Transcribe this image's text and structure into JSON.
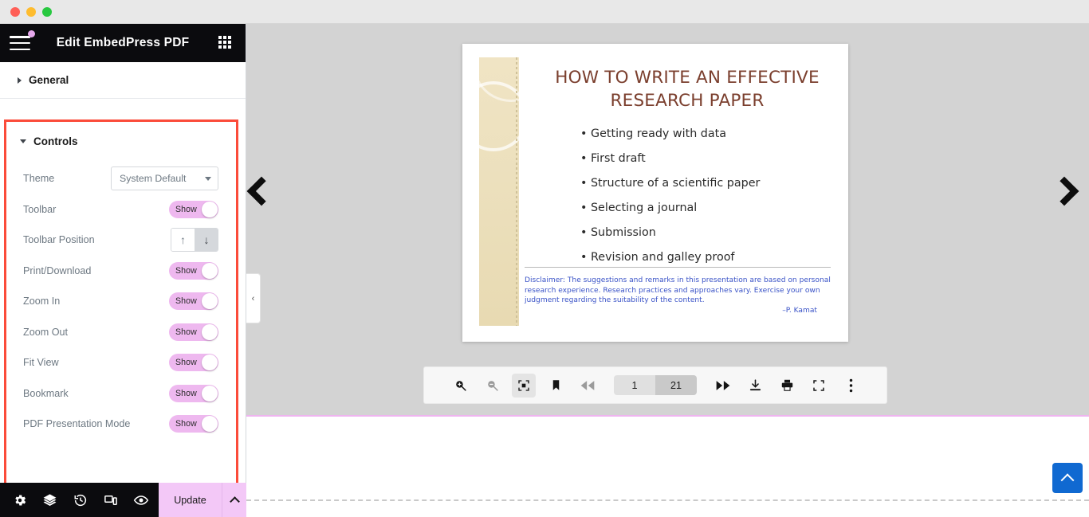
{
  "window": {
    "traffic_lights": [
      "close",
      "minimize",
      "maximize"
    ]
  },
  "panel": {
    "title": "Edit EmbedPress PDF",
    "menu_icon": "hamburger-icon",
    "apps_icon": "grid-icon",
    "sections": {
      "general": {
        "label": "General",
        "expanded": false
      },
      "controls": {
        "label": "Controls",
        "expanded": true,
        "highlighted": true
      }
    },
    "controls": [
      {
        "label": "Theme",
        "type": "select",
        "value": "System Default"
      },
      {
        "label": "Toolbar",
        "type": "toggle",
        "state": "Show"
      },
      {
        "label": "Toolbar Position",
        "type": "segmented",
        "options": [
          "↑",
          "↓"
        ],
        "selected": 1
      },
      {
        "label": "Print/Download",
        "type": "toggle",
        "state": "Show"
      },
      {
        "label": "Zoom In",
        "type": "toggle",
        "state": "Show"
      },
      {
        "label": "Zoom Out",
        "type": "toggle",
        "state": "Show"
      },
      {
        "label": "Fit View",
        "type": "toggle",
        "state": "Show"
      },
      {
        "label": "Bookmark",
        "type": "toggle",
        "state": "Show"
      },
      {
        "label": "PDF Presentation Mode",
        "type": "toggle",
        "state": "Show"
      }
    ],
    "footer": {
      "icons": [
        "gear-icon",
        "layers-icon",
        "history-icon",
        "responsive-icon",
        "preview-eye-icon"
      ],
      "update_label": "Update",
      "update_caret": "chevron-up-icon"
    }
  },
  "viewer": {
    "prev_arrow": "chevron-left-icon",
    "next_arrow": "chevron-right-icon",
    "collapse_tab": "‹",
    "slide": {
      "title": "HOW TO WRITE AN EFFECTIVE RESEARCH PAPER",
      "bullets": [
        "Getting ready with data",
        "First draft",
        "Structure of a scientific paper",
        "Selecting a journal",
        "Submission",
        "Revision and galley proof"
      ],
      "disclaimer": "Disclaimer: The suggestions and remarks in this presentation are based on personal research experience. Research practices and approaches vary. Exercise your own judgment regarding the suitability of the content.",
      "signature": "–P. Kamat"
    },
    "toolbar": {
      "zoom_in": "zoom-in-icon",
      "zoom_out": "zoom-out-icon",
      "fit_view": "fit-view-icon",
      "bookmark": "bookmark-icon",
      "prev": "fast-rewind-icon",
      "current_page": "1",
      "total_pages": "21",
      "next": "fast-forward-icon",
      "download": "download-icon",
      "print": "print-icon",
      "fullscreen": "fullscreen-icon",
      "more": "more-vertical-icon"
    },
    "scroll_top": "chevron-up-icon"
  },
  "colors": {
    "accent_pink": "#eeb8ef",
    "highlight_red": "#fb4b3a",
    "panel_dark": "#0b0b0e",
    "to_top_blue": "#1069d1",
    "slide_title_brown": "#7b3f2e",
    "disclaimer_blue": "#3a53c7"
  }
}
